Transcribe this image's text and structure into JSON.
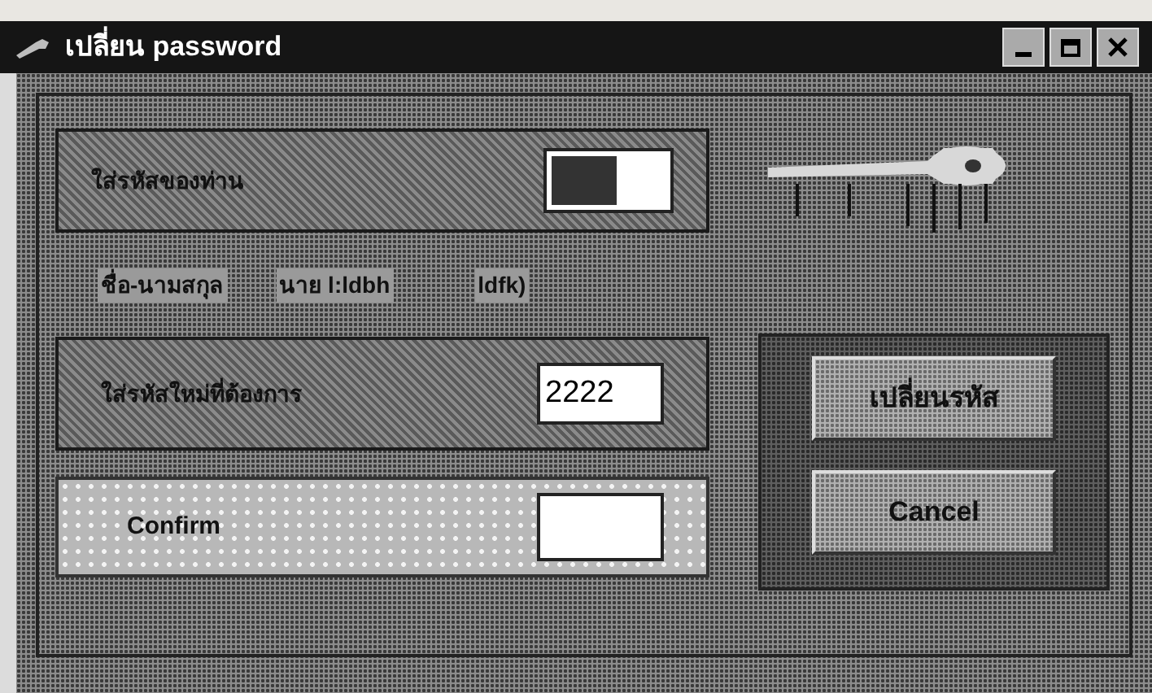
{
  "window": {
    "title": "เปลี่ยน password"
  },
  "old_password": {
    "label": "ใส่รหัสของท่าน"
  },
  "name_row": {
    "label": "ชื่อ-นามสกุล",
    "value": "นาย l:ldbh",
    "note": "ldfk)"
  },
  "new_password": {
    "label": "ใส่รหัสใหม่ที่ต้องการ",
    "value": "2222"
  },
  "confirm": {
    "label": "Confirm"
  },
  "buttons": [
    "เปลี่ยนรหัส",
    "Cancel"
  ]
}
